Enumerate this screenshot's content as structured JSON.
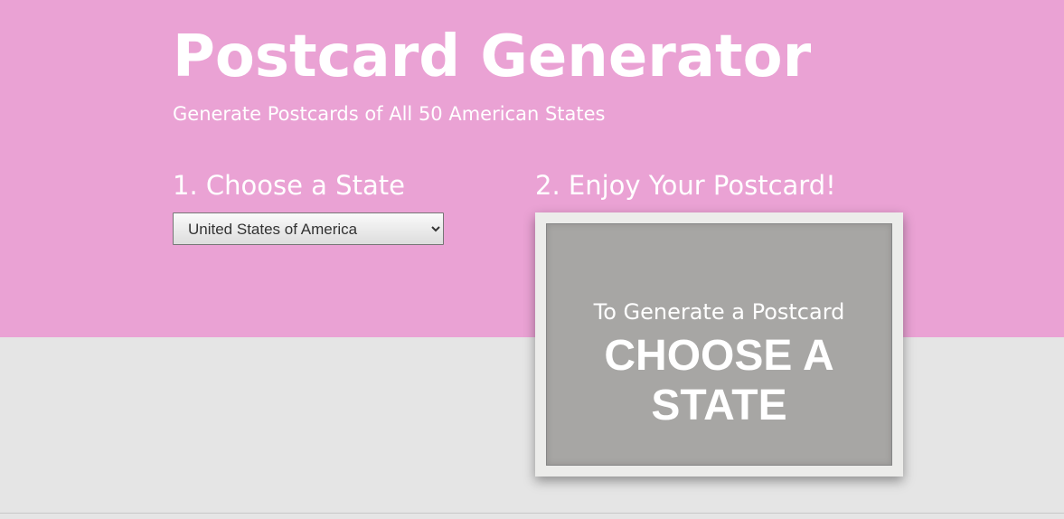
{
  "header": {
    "title": "Postcard Generator",
    "subtitle": "Generate Postcards of All 50 American States"
  },
  "steps": {
    "step1_label": "1. Choose a State",
    "step2_label": "2. Enjoy Your Postcard!"
  },
  "state_select": {
    "selected": "United States of America"
  },
  "postcard": {
    "hint": "To Generate a Postcard",
    "cta": "CHOOSE A STATE"
  },
  "colors": {
    "hero_background": "#eaa2d4",
    "page_background": "#e5e5e5",
    "postcard_frame": "#ececea",
    "postcard_face": "#a7a6a4",
    "text": "#ffffff"
  }
}
